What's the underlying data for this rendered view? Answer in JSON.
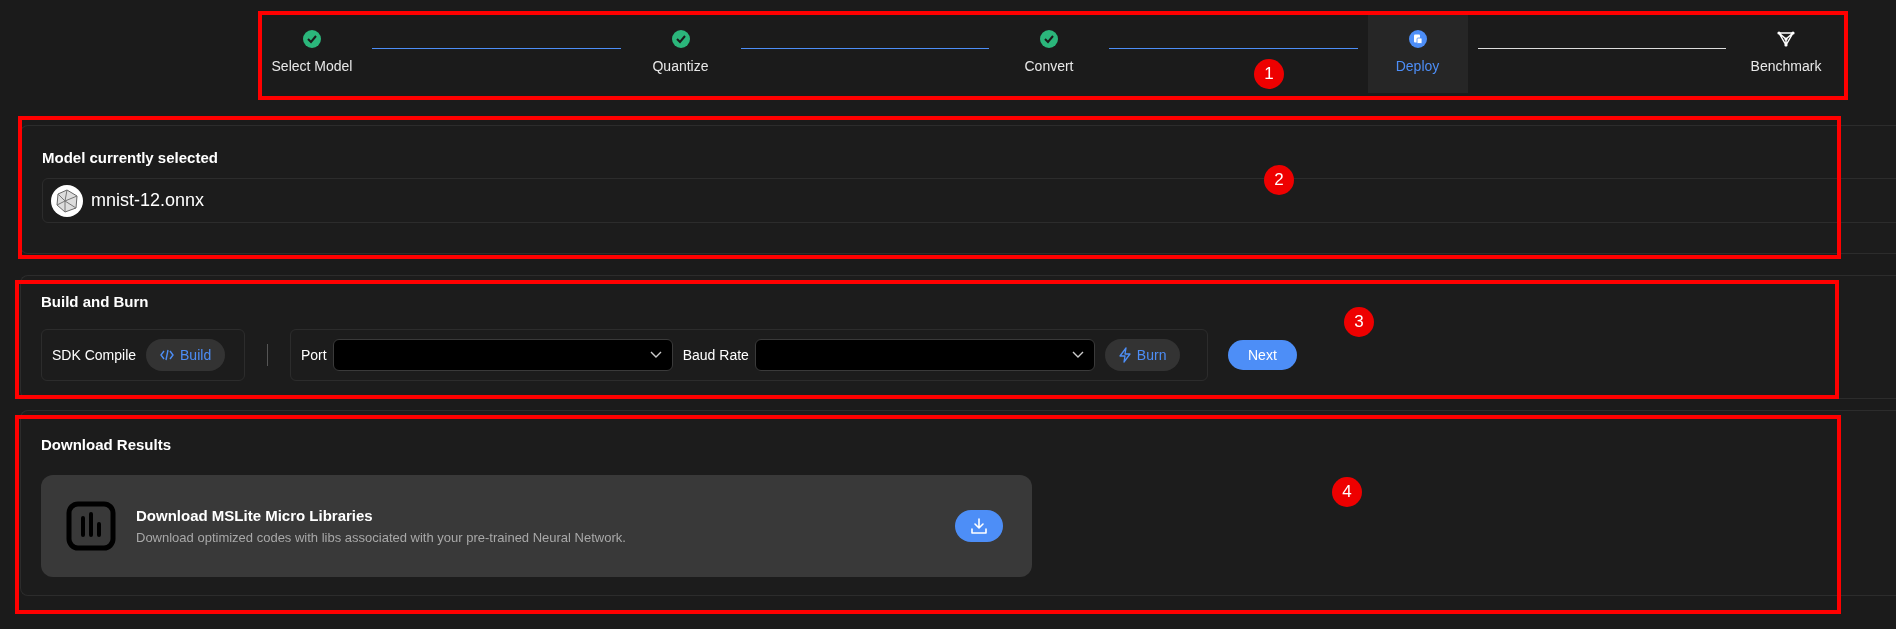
{
  "stepper": {
    "steps": [
      {
        "label": "Select Model",
        "completed": true,
        "selected": false
      },
      {
        "label": "Quantize",
        "completed": true,
        "selected": false
      },
      {
        "label": "Convert",
        "completed": true,
        "selected": false
      },
      {
        "label": "Deploy",
        "completed": false,
        "selected": true
      },
      {
        "label": "Benchmark",
        "completed": false,
        "selected": false
      }
    ]
  },
  "model_section": {
    "title": "Model currently selected",
    "model_name": "mnist-12.onnx"
  },
  "build_section": {
    "title": "Build and Burn",
    "sdk_label": "SDK Compile",
    "build_button": "Build",
    "port_label": "Port",
    "baud_label": "Baud Rate",
    "burn_button": "Burn",
    "next_button": "Next"
  },
  "download_section": {
    "title": "Download Results",
    "item_title": "Download MSLite Micro Libraries",
    "item_description": "Download optimized codes with libs associated with your pre-trained Neural Network."
  },
  "annotations": [
    {
      "number": "1"
    },
    {
      "number": "2"
    },
    {
      "number": "3"
    },
    {
      "number": "4"
    }
  ]
}
